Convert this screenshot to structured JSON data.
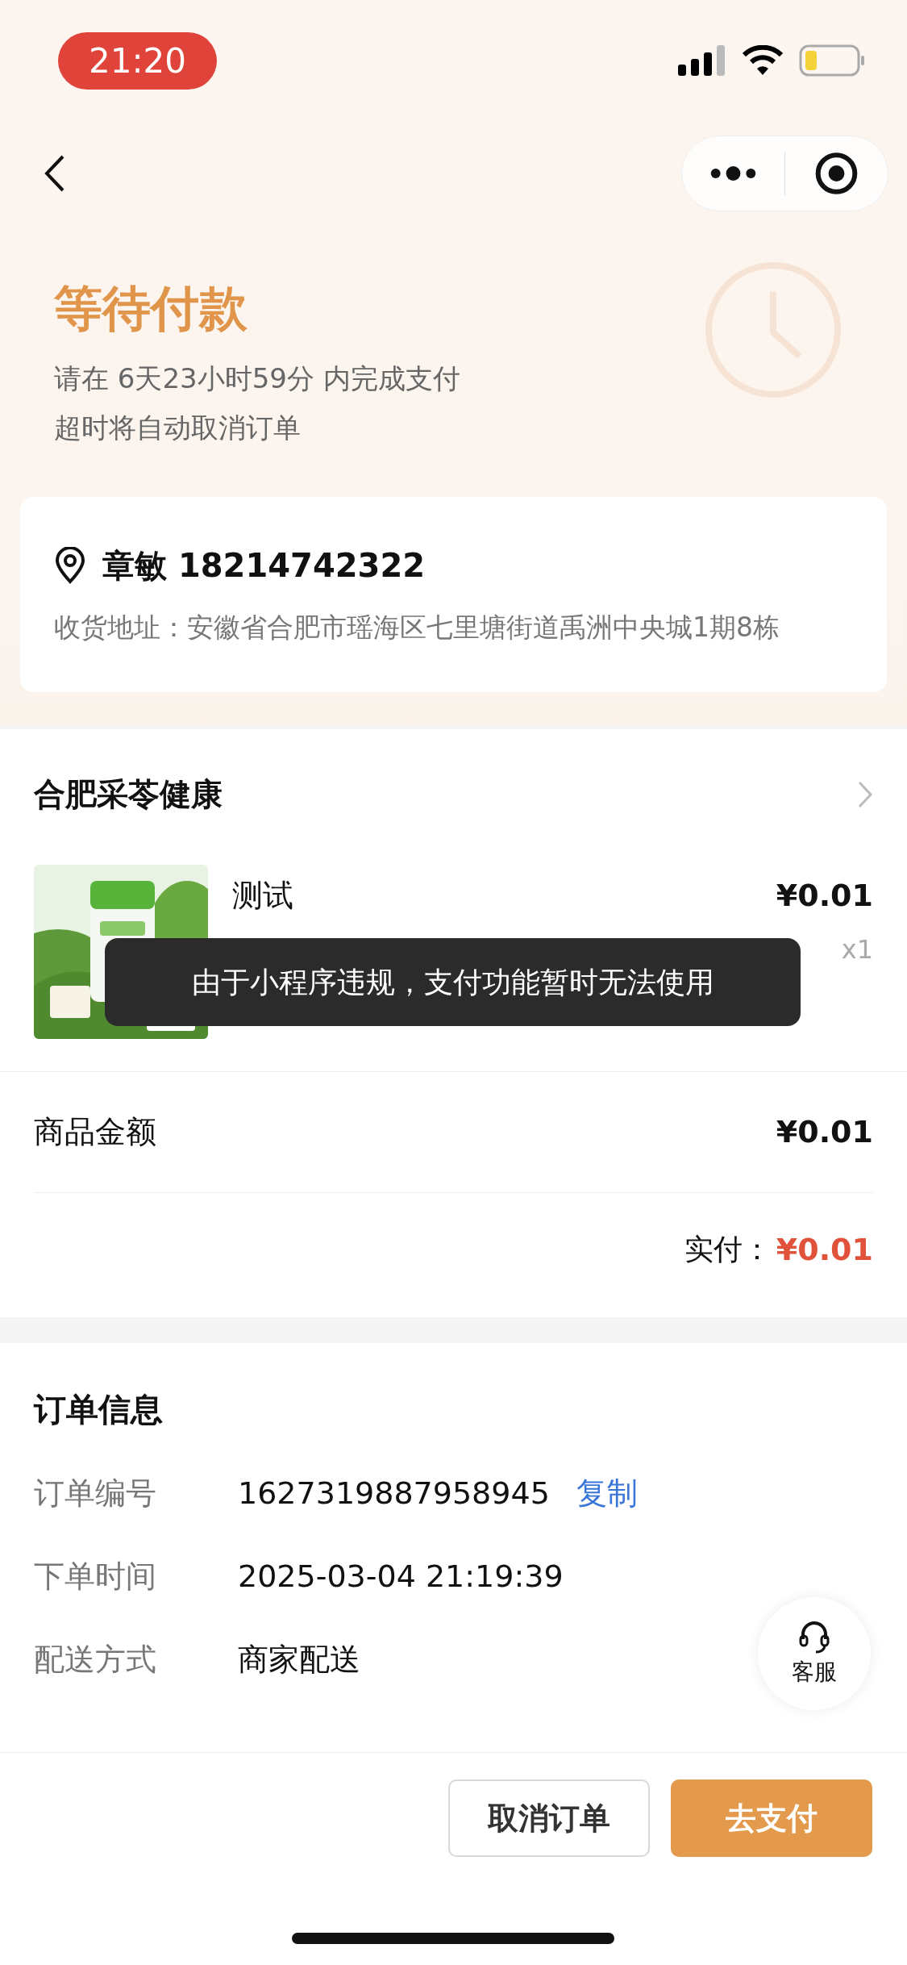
{
  "status_bar": {
    "time": "21:20"
  },
  "header": {
    "title": "等待付款",
    "countdown": "请在 6天23小时59分 内完成支付",
    "notice": "超时将自动取消订单"
  },
  "address": {
    "name_phone": "章敏 18214742322",
    "address": "收货地址：安徽省合肥市瑶海区七里塘街道禹洲中央城1期8栋"
  },
  "store": {
    "name": "合肥采苓健康",
    "items": [
      {
        "kind": "picture",
        "name": "测试",
        "price": "¥0.01",
        "quantity": "x1"
      }
    ]
  },
  "toast": "由于小程序违规，支付功能暂时无法使用",
  "amounts": {
    "subtotal_label": "商品金额",
    "subtotal": "¥0.01",
    "paid_label": "实付：",
    "paid": "¥0.01"
  },
  "order_info": {
    "title": "订单信息",
    "rows": [
      {
        "label": "订单编号",
        "value": "1627319887958945",
        "action": "复制"
      },
      {
        "label": "下单时间",
        "value": "2025-03-04 21:19:39"
      },
      {
        "label": "配送方式",
        "value": "商家配送"
      }
    ]
  },
  "customer_service": {
    "label": "客服"
  },
  "buttons": [
    {
      "label": "取消订单",
      "kind": "outline"
    },
    {
      "label": "去支付",
      "kind": "primary"
    }
  ]
}
